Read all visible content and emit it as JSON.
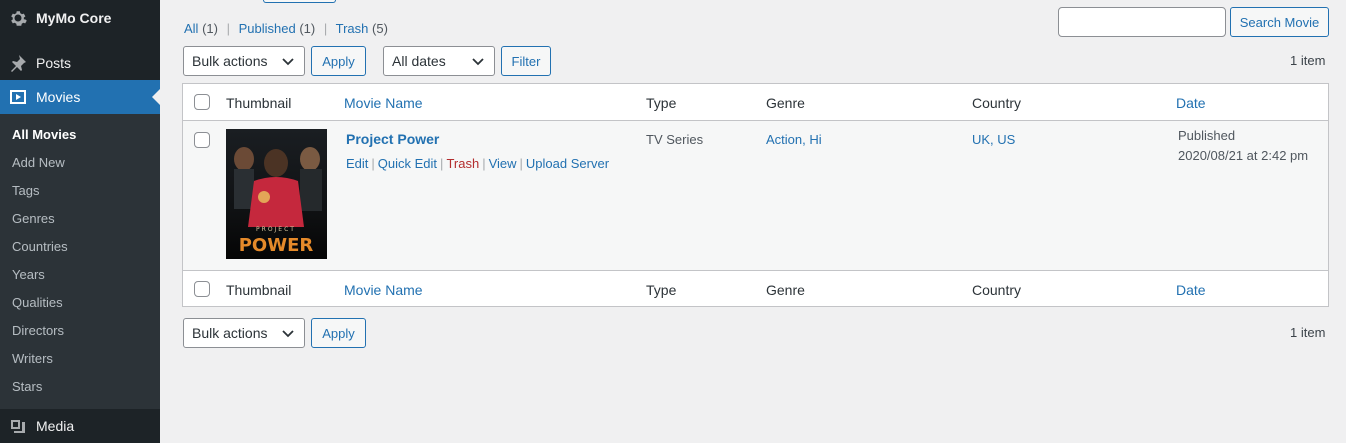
{
  "sidebar": {
    "top_items": [
      {
        "label": "MyMo Core",
        "icon": "gear-icon"
      },
      {
        "label": "Posts",
        "icon": "pushpin-icon"
      },
      {
        "label": "Movies",
        "icon": "video-icon"
      },
      {
        "label": "Media",
        "icon": "media-icon"
      }
    ],
    "submenu": [
      {
        "label": "All Movies"
      },
      {
        "label": "Add New"
      },
      {
        "label": "Tags"
      },
      {
        "label": "Genres"
      },
      {
        "label": "Countries"
      },
      {
        "label": "Years"
      },
      {
        "label": "Qualities"
      },
      {
        "label": "Directors"
      },
      {
        "label": "Writers"
      },
      {
        "label": "Stars"
      }
    ]
  },
  "filters": {
    "all": {
      "label": "All",
      "count": "(1)"
    },
    "published": {
      "label": "Published",
      "count": "(1)"
    },
    "trash": {
      "label": "Trash",
      "count": "(5)"
    },
    "separator": "|"
  },
  "search": {
    "button_label": "Search Movie",
    "value": ""
  },
  "toolbar": {
    "bulk_actions": "Bulk actions",
    "apply": "Apply",
    "all_dates": "All dates",
    "filter": "Filter",
    "items_count": "1 item"
  },
  "table": {
    "headers": {
      "thumbnail": "Thumbnail",
      "movie_name": "Movie Name",
      "type": "Type",
      "genre": "Genre",
      "country": "Country",
      "date": "Date"
    },
    "rows": [
      {
        "title": "Project Power",
        "poster_text_small": "PROJECT",
        "poster_text_big": "POWER",
        "actions": {
          "edit": "Edit",
          "quick_edit": "Quick Edit",
          "trash": "Trash",
          "view": "View",
          "upload": "Upload Server"
        },
        "type": "TV Series",
        "genre": "Action, Hi",
        "country": "UK, US",
        "status": "Published",
        "date": "2020/08/21 at 2:42 pm"
      }
    ]
  }
}
